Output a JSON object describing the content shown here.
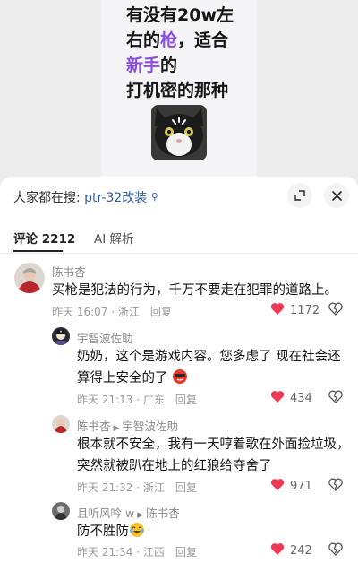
{
  "video": {
    "line1": "有没有20w左",
    "line2_a": "右的",
    "line2_hl": "枪",
    "line2_b": "，适合",
    "line3_hl": "新手",
    "line3_b": "的",
    "line4": "打机密的那种"
  },
  "search": {
    "prefix": "大家都在搜:",
    "query": "ptr-32改装",
    "search_icon": "search-icon"
  },
  "tabs": {
    "comments": "评论 2212",
    "ai": "AI 解析"
  },
  "comments": [
    {
      "name": "陈书杏",
      "text": "买枪是犯法的行为，千万不要走在犯罪的道路上。",
      "time": "昨天 16:07 · 浙江",
      "reply": "回复",
      "likes": "1172"
    },
    {
      "name": "宇智波佐助",
      "text1": "奶奶，这个是游戏内容。您多虑了 现在社会还",
      "text2": "算得上安全的了",
      "time": "昨天 21:13 · 广东",
      "reply": "回复",
      "likes": "434"
    },
    {
      "name": "陈书杏",
      "reply_to": "宇智波佐助",
      "text1": "根本就不安全，我有一天哼着歌在外面捡垃圾，",
      "text2": "突然就被趴在地上的红狼给夺舍了",
      "time": "昨天 21:32 · 浙江",
      "reply": "回复",
      "likes": "971"
    },
    {
      "name": "且听风吟 w",
      "reply_to": "陈书杏",
      "text": "防不胜防",
      "time": "昨天 21:34 · 江西",
      "reply": "回复",
      "likes": "242"
    }
  ],
  "colors": {
    "like_red": "#f03a55",
    "link_blue": "#2e5ea8",
    "highlight_purple": "#8a4fe0"
  }
}
